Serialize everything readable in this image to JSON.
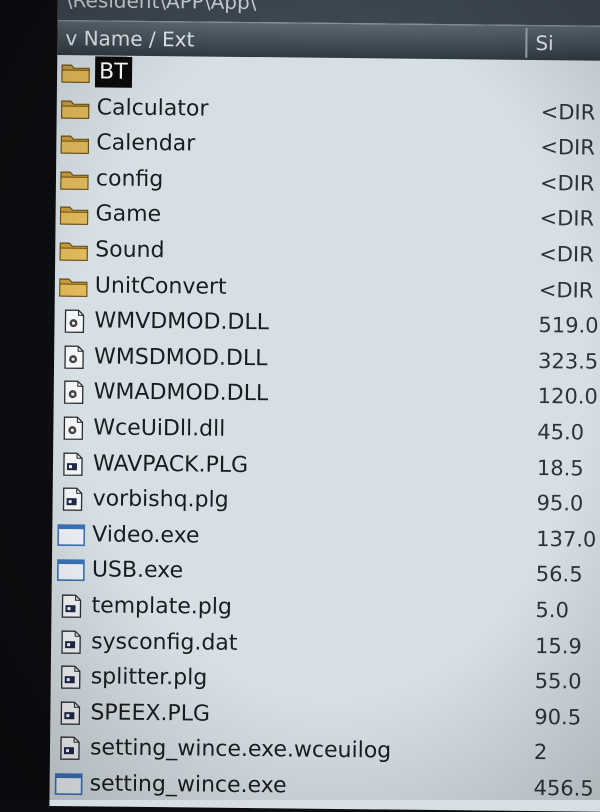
{
  "window": {
    "path": "\\Resident\\APP\\App\\"
  },
  "columns": {
    "name": "v Name / Ext",
    "size": "Si"
  },
  "files": [
    {
      "name": "BT",
      "size": "",
      "icon": "folder-icon",
      "selected": true
    },
    {
      "name": "Calculator",
      "size": "<DIR",
      "icon": "folder-icon"
    },
    {
      "name": "Calendar",
      "size": "<DIR",
      "icon": "folder-icon"
    },
    {
      "name": "config",
      "size": "<DIR",
      "icon": "folder-icon"
    },
    {
      "name": "Game",
      "size": "<DIR",
      "icon": "folder-icon"
    },
    {
      "name": "Sound",
      "size": "<DIR",
      "icon": "folder-icon"
    },
    {
      "name": "UnitConvert",
      "size": "<DIR",
      "icon": "folder-icon"
    },
    {
      "name": "WMVDMOD.DLL",
      "size": "519.0",
      "icon": "dll-file-icon"
    },
    {
      "name": "WMSDMOD.DLL",
      "size": "323.5",
      "icon": "dll-file-icon"
    },
    {
      "name": "WMADMOD.DLL",
      "size": "120.0",
      "icon": "dll-file-icon"
    },
    {
      "name": "WceUiDll.dll",
      "size": "45.0",
      "icon": "dll-file-icon"
    },
    {
      "name": "WAVPACK.PLG",
      "size": "18.5",
      "icon": "plugin-file-icon"
    },
    {
      "name": "vorbishq.plg",
      "size": "95.0",
      "icon": "plugin-file-icon"
    },
    {
      "name": "Video.exe",
      "size": "137.0",
      "icon": "exe-window-icon"
    },
    {
      "name": "USB.exe",
      "size": "56.5",
      "icon": "exe-window-icon"
    },
    {
      "name": "template.plg",
      "size": "5.0",
      "icon": "plugin-file-icon"
    },
    {
      "name": "sysconfig.dat",
      "size": "15.9",
      "icon": "plugin-file-icon"
    },
    {
      "name": "splitter.plg",
      "size": "55.0",
      "icon": "plugin-file-icon"
    },
    {
      "name": "SPEEX.PLG",
      "size": "90.5",
      "icon": "plugin-file-icon"
    },
    {
      "name": "setting_wince.exe.wceuilog",
      "size": "2",
      "icon": "plugin-file-icon"
    },
    {
      "name": "setting_wince.exe",
      "size": "456.5",
      "icon": "exe-window-icon"
    }
  ],
  "colors": {
    "background": "#d6dfe4",
    "header": "#3c4650",
    "selection": "#0a0a0a",
    "folder": "#c89b3c"
  }
}
